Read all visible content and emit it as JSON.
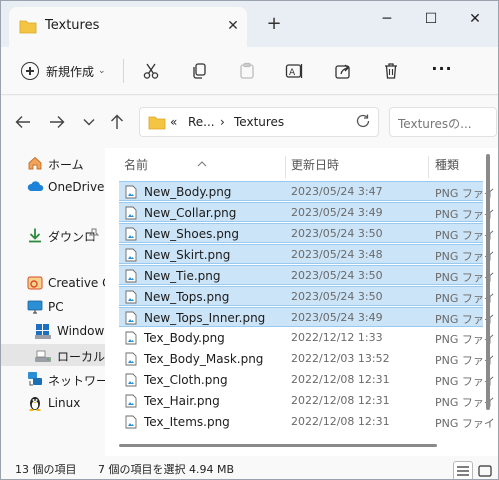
{
  "window": {
    "tab_title": "Textures",
    "tab_close": "✕",
    "new_tab": "+",
    "min": "─",
    "max": "☐",
    "close": "✕"
  },
  "toolbar": {
    "new_label": "新規作成",
    "new_caret": "⌄",
    "more": "···"
  },
  "address": {
    "chevrons": "«",
    "crumb1": "Re...",
    "sep": "›",
    "crumb2": "Textures",
    "search_placeholder": "Texturesの..."
  },
  "sidebar": {
    "items": [
      {
        "label": "ホーム",
        "icon": "home-icon"
      },
      {
        "label": "OneDrive",
        "icon": "cloud-icon"
      },
      {
        "label": "ダウンロ",
        "icon": "download-icon"
      },
      {
        "label": "Creative C",
        "icon": "creative-cloud-icon"
      },
      {
        "label": "PC",
        "icon": "pc-icon"
      },
      {
        "label": "Window",
        "icon": "windows-drive-icon"
      },
      {
        "label": "ローカル デ",
        "icon": "local-drive-icon"
      },
      {
        "label": "ネットワーク",
        "icon": "network-icon"
      },
      {
        "label": "Linux",
        "icon": "linux-icon"
      }
    ]
  },
  "columns": {
    "name": "名前",
    "date": "更新日時",
    "type": "種類"
  },
  "files": [
    {
      "name": "New_Body.png",
      "date": "2023/05/24 3:47",
      "type": "PNG ファイ",
      "selected": true
    },
    {
      "name": "New_Collar.png",
      "date": "2023/05/24 3:49",
      "type": "PNG ファイ",
      "selected": true
    },
    {
      "name": "New_Shoes.png",
      "date": "2023/05/24 3:50",
      "type": "PNG ファイ",
      "selected": true
    },
    {
      "name": "New_Skirt.png",
      "date": "2023/05/24 3:48",
      "type": "PNG ファイ",
      "selected": true
    },
    {
      "name": "New_Tie.png",
      "date": "2023/05/24 3:50",
      "type": "PNG ファイ",
      "selected": true
    },
    {
      "name": "New_Tops.png",
      "date": "2023/05/24 3:50",
      "type": "PNG ファイ",
      "selected": true
    },
    {
      "name": "New_Tops_Inner.png",
      "date": "2023/05/24 3:49",
      "type": "PNG ファイ",
      "selected": true
    },
    {
      "name": "Tex_Body.png",
      "date": "2022/12/12 1:33",
      "type": "PNG ファイ",
      "selected": false
    },
    {
      "name": "Tex_Body_Mask.png",
      "date": "2022/12/03 13:52",
      "type": "PNG ファイ",
      "selected": false
    },
    {
      "name": "Tex_Cloth.png",
      "date": "2022/12/08 12:31",
      "type": "PNG ファイ",
      "selected": false
    },
    {
      "name": "Tex_Hair.png",
      "date": "2022/12/08 12:31",
      "type": "PNG ファイ",
      "selected": false
    },
    {
      "name": "Tex_Items.png",
      "date": "2022/12/08 12:31",
      "type": "PNG ファイ",
      "selected": false
    }
  ],
  "status": {
    "count": "13 個の項目",
    "selection": "7 個の項目を選択  4.94 MB"
  },
  "colors": {
    "selection_bg": "#cce4f7",
    "selection_border": "#99c9ef",
    "folder": "#f4c542",
    "accent": "#0067c0"
  }
}
